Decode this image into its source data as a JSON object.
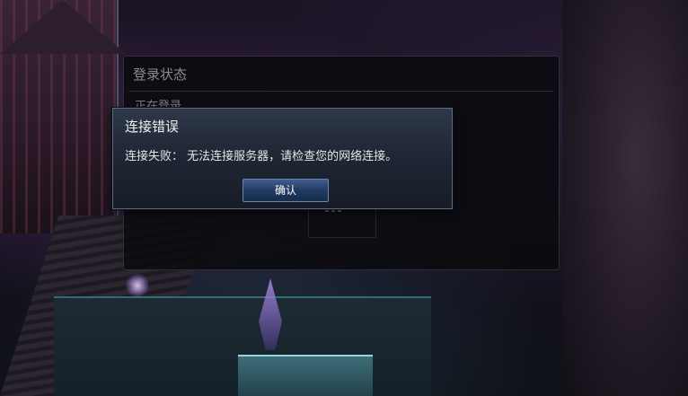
{
  "status_panel": {
    "title": "登录状态",
    "status_text": "正在登录……"
  },
  "error_dialog": {
    "title": "连接错误",
    "message": "连接失败： 无法连接服务器，请检查您的网络连接。",
    "confirm_label": "确认"
  },
  "colors": {
    "dialog_border": "#5d6b82",
    "button_top": "#3f5e8d",
    "button_bottom": "#172c4d",
    "panel_bg": "#0a0a0e"
  }
}
